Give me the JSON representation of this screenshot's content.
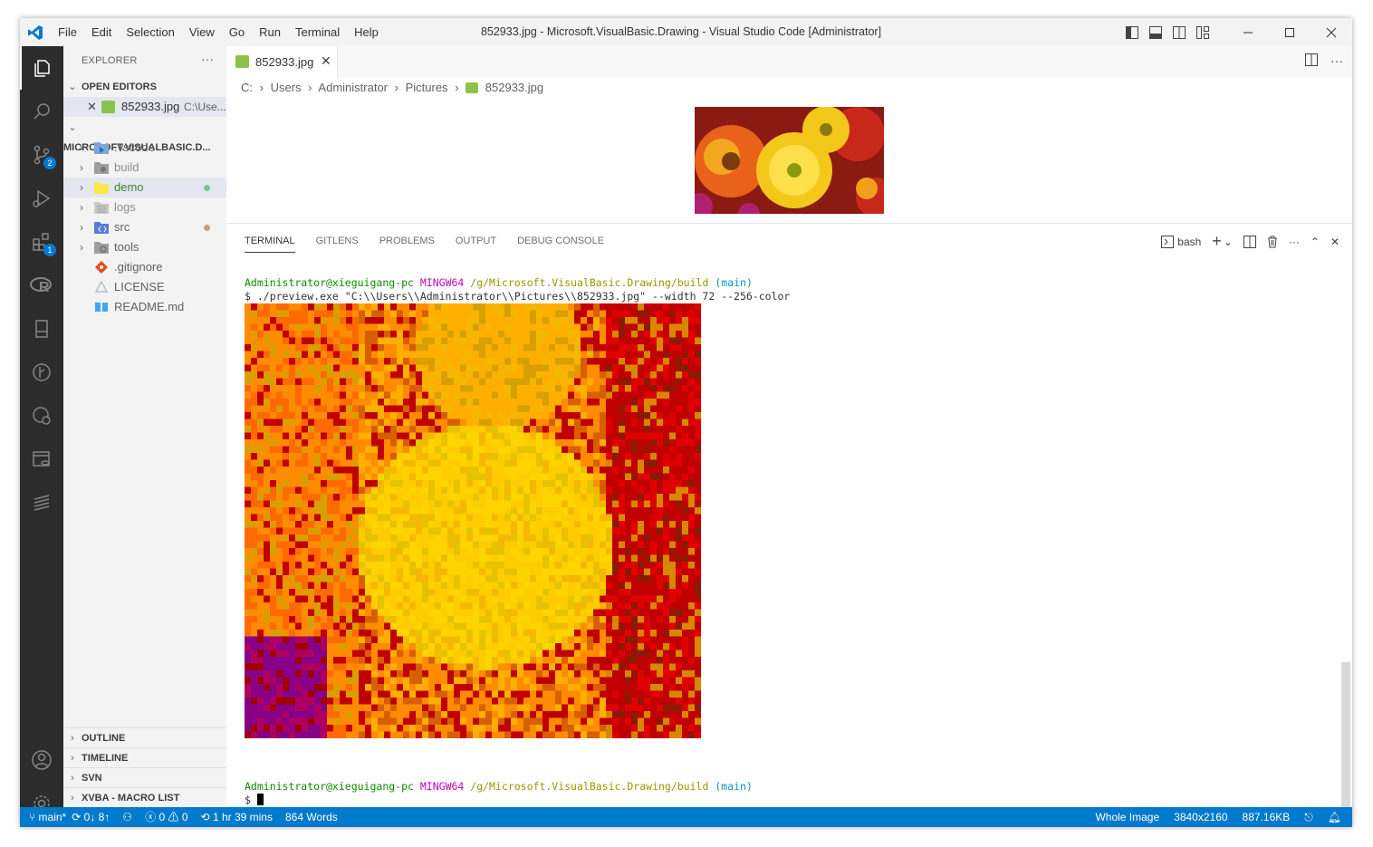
{
  "titlebar": {
    "menu": [
      "File",
      "Edit",
      "Selection",
      "View",
      "Go",
      "Run",
      "Terminal",
      "Help"
    ],
    "title": "852933.jpg - Microsoft.VisualBasic.Drawing - Visual Studio Code [Administrator]"
  },
  "activity": {
    "items": [
      "files-icon",
      "search-icon",
      "source-control-icon",
      "run-debug-icon",
      "extensions-icon",
      "r-icon",
      "book-icon",
      "gitlens-icon",
      "git-history-icon",
      "database-icon",
      "svn-icon"
    ],
    "source_control_badge": "2",
    "extensions_badge": "1"
  },
  "sidebar": {
    "header": "EXPLORER",
    "open_editors": "OPEN EDITORS",
    "open_file": "852933.jpg",
    "open_file_path": "C:\\Use...",
    "project": "MICROSOFT.VISUALBASIC.D...",
    "tree": [
      {
        "label": ".vscode",
        "color": "#616161"
      },
      {
        "label": "build",
        "color": "#8e8e8e"
      },
      {
        "label": "demo",
        "color": "#388a34",
        "dot": "#73c991"
      },
      {
        "label": "logs",
        "color": "#8e8e8e"
      },
      {
        "label": "src",
        "color": "#616161",
        "dot": "#c5a17b"
      },
      {
        "label": "tools",
        "color": "#616161"
      },
      {
        "label": ".gitignore",
        "color": "#616161"
      },
      {
        "label": "LICENSE",
        "color": "#616161"
      },
      {
        "label": "README.md",
        "color": "#616161"
      }
    ],
    "bottom_sections": [
      "OUTLINE",
      "TIMELINE",
      "SVN",
      "XVBA - MACRO LIST"
    ]
  },
  "editor": {
    "tab_label": "852933.jpg",
    "breadcrumb": [
      "C:",
      "Users",
      "Administrator",
      "Pictures",
      "852933.jpg"
    ]
  },
  "panel": {
    "tabs": [
      "TERMINAL",
      "GITLENS",
      "PROBLEMS",
      "OUTPUT",
      "DEBUG CONSOLE"
    ],
    "shell": "bash",
    "prompt": {
      "user": "Administrator@xieguigang-pc",
      "env": "MINGW64",
      "path": "/g/Microsoft.VisualBasic.Drawing/build",
      "branch": "(main)"
    },
    "command": "$ ./preview.exe \"C:\\\\Users\\\\Administrator\\\\Pictures\\\\852933.jpg\" --width 72 --256-color",
    "prompt_symbol": "$ "
  },
  "status": {
    "branch": "main*",
    "sync": "0↓ 8↑",
    "errors": "0",
    "warnings": "0",
    "time": "1 hr 39 mins",
    "words": "864 Words",
    "image_mode": "Whole Image",
    "dimensions": "3840x2160",
    "filesize": "887.16KB"
  }
}
